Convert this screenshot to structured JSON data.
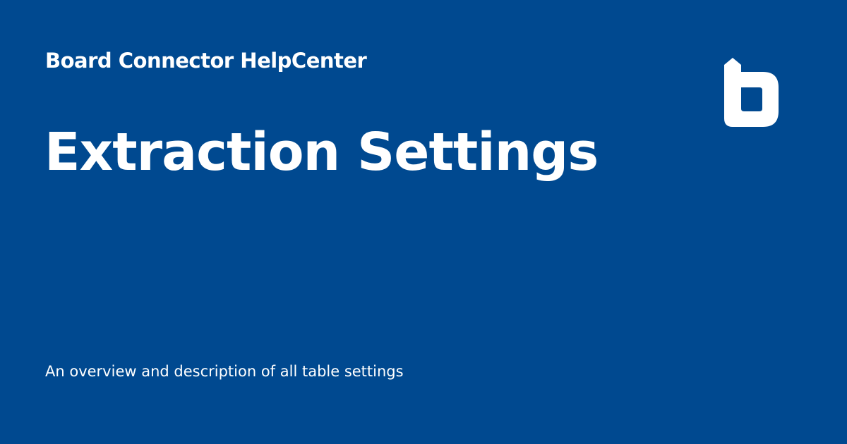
{
  "site": {
    "name": "Board Connector HelpCenter"
  },
  "page": {
    "title": "Extraction Settings",
    "description": "An overview and description of all table settings"
  },
  "logo": {
    "icon": "board-b-logo-icon"
  },
  "colors": {
    "background": "#004990",
    "text": "#ffffff"
  }
}
